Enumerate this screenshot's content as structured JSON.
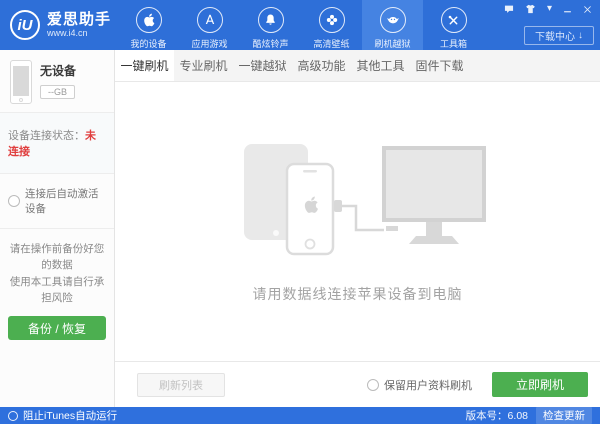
{
  "colors": {
    "header_blue": "#2e6fd8",
    "active_nav_blue": "#4583e2",
    "statusbar_blue": "#2f70dd",
    "primary_green": "#4caf50",
    "status_red": "#e03e3e"
  },
  "header": {
    "logo_mark": "iU",
    "logo_title": "爱思助手",
    "logo_url": "www.i4.cn",
    "nav": [
      {
        "label": "我的设备",
        "icon": "apple-icon"
      },
      {
        "label": "应用游戏",
        "icon": "appstore-icon"
      },
      {
        "label": "酷炫铃声",
        "icon": "bell-icon"
      },
      {
        "label": "高清壁纸",
        "icon": "flower-icon"
      },
      {
        "label": "刷机越狱",
        "icon": "jailbreak-icon",
        "active": true
      },
      {
        "label": "工具箱",
        "icon": "wrench-icon"
      }
    ],
    "window_icons": [
      "feedback-icon",
      "skin-icon",
      "menu-caret-icon",
      "minimize-icon",
      "close-icon"
    ],
    "download_button": "下载中心",
    "download_arrow": "↓"
  },
  "sidebar": {
    "device_name": "无设备",
    "capacity": "--GB",
    "status_label": "设备连接状态：",
    "status_value": "未连接",
    "auto_activate_label": "连接后自动激活设备",
    "warning_line1": "请在操作前备份好您的数据",
    "warning_line2": "使用本工具请自行承担风险",
    "backup_button": "备份 / 恢复"
  },
  "tabs": {
    "active_index": 0,
    "items": [
      {
        "label": "一键刷机"
      },
      {
        "label": "专业刷机"
      },
      {
        "label": "一键越狱"
      },
      {
        "label": "高级功能"
      },
      {
        "label": "其他工具"
      },
      {
        "label": "固件下载"
      }
    ]
  },
  "content": {
    "caption": "请用数据线连接苹果设备到电脑"
  },
  "action_bar": {
    "refresh_button": "刷新列表",
    "keep_user_data_label": "保留用户资料刷机",
    "flash_button": "立即刷机"
  },
  "status_bar": {
    "block_itunes_label": "阻止iTunes自动运行",
    "version_label": "版本号：6.08",
    "check_update_button": "检查更新"
  }
}
